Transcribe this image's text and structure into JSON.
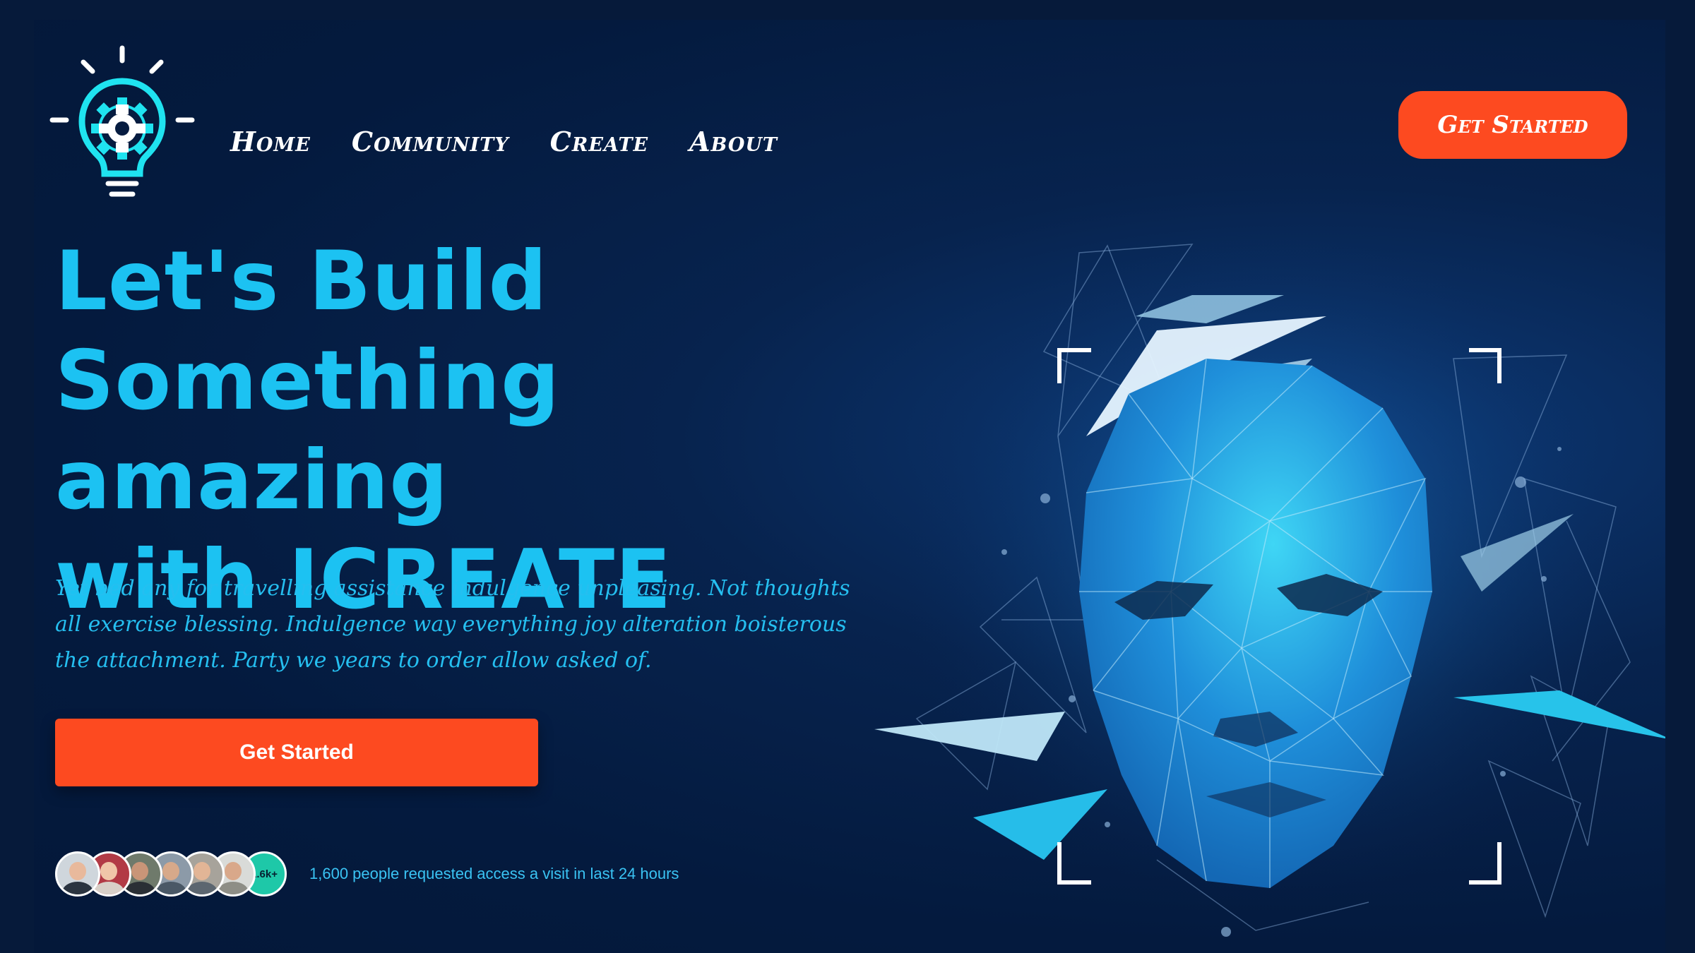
{
  "header": {
    "logo_icon": "lightbulb-gear-icon",
    "nav": [
      {
        "label": "Home"
      },
      {
        "label": "Community"
      },
      {
        "label": "Create"
      },
      {
        "label": "About"
      }
    ],
    "cta_label": "Get Started"
  },
  "hero": {
    "title_lines": [
      "Let's Build",
      "Something amazing",
      "with ICREATE"
    ],
    "description": "Yet bed any for travelling assistance indulgence unpleasing. Not thoughts all exercise blessing. Indulgence way everything joy alteration boisterous the attachment. Party we years to order allow asked of.",
    "cta_label": "Get Started",
    "illustration_icon": "polygon-face-icon"
  },
  "social_proof": {
    "avatar_count_label": "1.6k+",
    "text": "1,600 people requested access a visit in last 24 hours"
  },
  "colors": {
    "accent": "#fd4a20",
    "headline": "#1cc2f2",
    "logo_cyan": "#1fe3f0",
    "background": "#041a3e"
  }
}
